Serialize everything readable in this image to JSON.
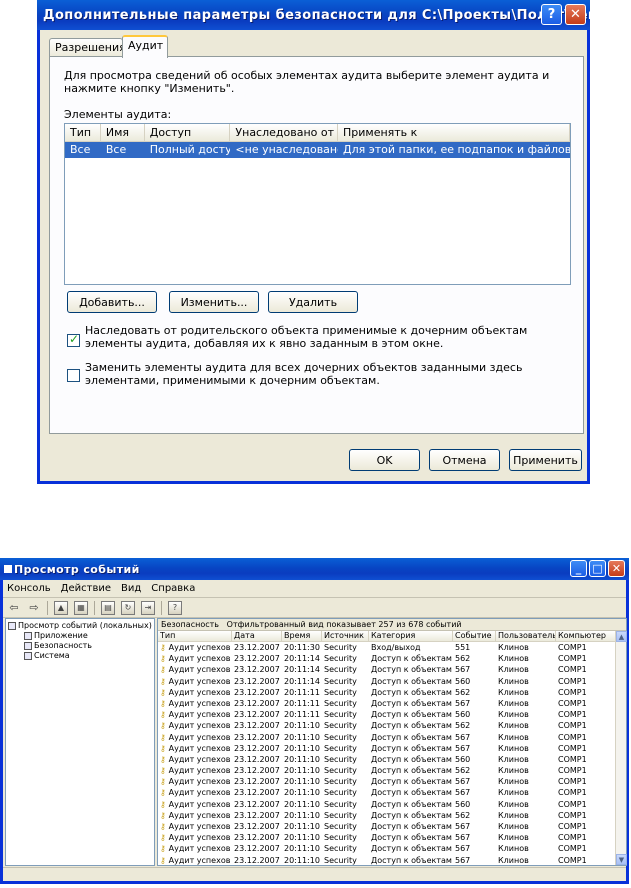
{
  "dialog": {
    "title": "Дополнительные параметры безопасности для C:\\Проекты\\Полет\\Тексто...",
    "help_btn": "?",
    "close_btn": "✕",
    "tabs": [
      "Разрешения",
      "Аудит"
    ],
    "description": "Для просмотра сведений об особых элементах аудита выберите элемент аудита и нажмите кнопку \"Изменить\".",
    "elements_label": "Элементы аудита:",
    "columns": [
      "Тип",
      "Имя",
      "Доступ",
      "Унаследовано от",
      "Применять к"
    ],
    "rows": [
      {
        "type": "Все",
        "name": "Все",
        "access": "Полный доступ",
        "inherited": "<не унаследовано>",
        "apply": "Для этой папки, ее подпапок и файлов"
      }
    ],
    "add_btn": "Добавить...",
    "edit_btn": "Изменить...",
    "delete_btn": "Удалить",
    "inherit_check": "Наследовать от родительского объекта применимые к дочерним объектам элементы аудита, добавляя их к явно заданным в этом окне.",
    "replace_check": "Заменить элементы аудита для всех дочерних объектов заданными здесь элементами, применимыми к дочерним объектам.",
    "ok_btn": "OK",
    "cancel_btn": "Отмена",
    "apply_btn": "Применить"
  },
  "viewer": {
    "title": "Просмотр событий",
    "min_btn": "_",
    "max_btn": "□",
    "close_btn": "✕",
    "menu": [
      "Консоль",
      "Действие",
      "Вид",
      "Справка"
    ],
    "tree": [
      "Просмотр событий (локальных)",
      "Приложение",
      "Безопасность",
      "Система"
    ],
    "panel_title": "Безопасность",
    "filter_text": "Отфильтрованный вид показывает 257 из 678 событий",
    "columns": [
      "Тип",
      "Дата",
      "Время",
      "Источник",
      "Категория",
      "Событие",
      "Пользователь",
      "Компьютер"
    ],
    "events": [
      [
        "Аудит успехов",
        "23.12.2007",
        "20:11:30",
        "Security",
        "Вход/выход",
        "551",
        "Клинов",
        "COMP1"
      ],
      [
        "Аудит успехов",
        "23.12.2007",
        "20:11:14",
        "Security",
        "Доступ к объектам",
        "562",
        "Клинов",
        "COMP1"
      ],
      [
        "Аудит успехов",
        "23.12.2007",
        "20:11:14",
        "Security",
        "Доступ к объектам",
        "567",
        "Клинов",
        "COMP1"
      ],
      [
        "Аудит успехов",
        "23.12.2007",
        "20:11:14",
        "Security",
        "Доступ к объектам",
        "560",
        "Клинов",
        "COMP1"
      ],
      [
        "Аудит успехов",
        "23.12.2007",
        "20:11:11",
        "Security",
        "Доступ к объектам",
        "562",
        "Клинов",
        "COMP1"
      ],
      [
        "Аудит успехов",
        "23.12.2007",
        "20:11:11",
        "Security",
        "Доступ к объектам",
        "567",
        "Клинов",
        "COMP1"
      ],
      [
        "Аудит успехов",
        "23.12.2007",
        "20:11:11",
        "Security",
        "Доступ к объектам",
        "560",
        "Клинов",
        "COMP1"
      ],
      [
        "Аудит успехов",
        "23.12.2007",
        "20:11:10",
        "Security",
        "Доступ к объектам",
        "562",
        "Клинов",
        "COMP1"
      ],
      [
        "Аудит успехов",
        "23.12.2007",
        "20:11:10",
        "Security",
        "Доступ к объектам",
        "567",
        "Клинов",
        "COMP1"
      ],
      [
        "Аудит успехов",
        "23.12.2007",
        "20:11:10",
        "Security",
        "Доступ к объектам",
        "567",
        "Клинов",
        "COMP1"
      ],
      [
        "Аудит успехов",
        "23.12.2007",
        "20:11:10",
        "Security",
        "Доступ к объектам",
        "560",
        "Клинов",
        "COMP1"
      ],
      [
        "Аудит успехов",
        "23.12.2007",
        "20:11:10",
        "Security",
        "Доступ к объектам",
        "562",
        "Клинов",
        "COMP1"
      ],
      [
        "Аудит успехов",
        "23.12.2007",
        "20:11:10",
        "Security",
        "Доступ к объектам",
        "567",
        "Клинов",
        "COMP1"
      ],
      [
        "Аудит успехов",
        "23.12.2007",
        "20:11:10",
        "Security",
        "Доступ к объектам",
        "567",
        "Клинов",
        "COMP1"
      ],
      [
        "Аудит успехов",
        "23.12.2007",
        "20:11:10",
        "Security",
        "Доступ к объектам",
        "560",
        "Клинов",
        "COMP1"
      ],
      [
        "Аудит успехов",
        "23.12.2007",
        "20:11:10",
        "Security",
        "Доступ к объектам",
        "562",
        "Клинов",
        "COMP1"
      ],
      [
        "Аудит успехов",
        "23.12.2007",
        "20:11:10",
        "Security",
        "Доступ к объектам",
        "567",
        "Клинов",
        "COMP1"
      ],
      [
        "Аудит успехов",
        "23.12.2007",
        "20:11:10",
        "Security",
        "Доступ к объектам",
        "567",
        "Клинов",
        "COMP1"
      ],
      [
        "Аудит успехов",
        "23.12.2007",
        "20:11:10",
        "Security",
        "Доступ к объектам",
        "567",
        "Клинов",
        "COMP1"
      ],
      [
        "Аудит успехов",
        "23.12.2007",
        "20:11:10",
        "Security",
        "Доступ к объектам",
        "567",
        "Клинов",
        "COMP1"
      ]
    ]
  }
}
